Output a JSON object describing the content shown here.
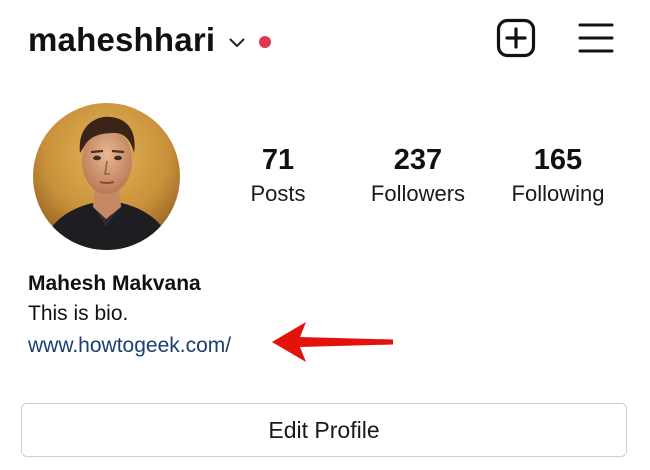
{
  "header": {
    "username": "maheshhari",
    "chevron_icon": "chevron-down-icon",
    "notification_dot_color": "#e0394f",
    "new_post_icon": "plus-square-icon",
    "menu_icon": "hamburger-menu-icon"
  },
  "profile": {
    "avatar_icon": "profile-photo",
    "stats": [
      {
        "value": "71",
        "label": "Posts"
      },
      {
        "value": "237",
        "label": "Followers"
      },
      {
        "value": "165",
        "label": "Following"
      }
    ],
    "full_name": "Mahesh Makvana",
    "bio": "This is bio.",
    "website": "www.howtogeek.com/",
    "annotation_arrow_color": "#e3120b"
  },
  "actions": {
    "edit_profile_label": "Edit Profile"
  }
}
